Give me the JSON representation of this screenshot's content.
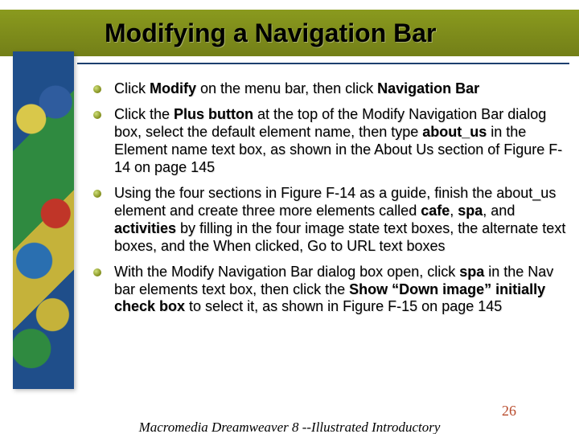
{
  "title": "Modifying a Navigation Bar",
  "bullets": [
    {
      "segments": [
        {
          "t": "Click "
        },
        {
          "t": "Modify",
          "b": true
        },
        {
          "t": " on the menu bar, then click "
        },
        {
          "t": "Navigation Bar",
          "b": true
        }
      ]
    },
    {
      "segments": [
        {
          "t": "Click the "
        },
        {
          "t": "Plus button",
          "b": true
        },
        {
          "t": " at the top of the Modify Navigation Bar dialog box, select the default element name, then type "
        },
        {
          "t": "about_us",
          "b": true
        },
        {
          "t": " in the Element name text box, as shown in the About Us section of Figure F-14 on page 145"
        }
      ]
    },
    {
      "segments": [
        {
          "t": "Using the four sections in Figure F-14 as a guide, finish the about_us element and create three more elements called "
        },
        {
          "t": "cafe",
          "b": true
        },
        {
          "t": ", "
        },
        {
          "t": "spa",
          "b": true
        },
        {
          "t": ", and "
        },
        {
          "t": "activities",
          "b": true
        },
        {
          "t": " by filling in the four image state text boxes, the alternate text boxes, and the When clicked, Go to URL text boxes"
        }
      ]
    },
    {
      "segments": [
        {
          "t": "With the Modify Navigation Bar dialog box open, click "
        },
        {
          "t": "spa",
          "b": true
        },
        {
          "t": " in the Nav bar elements text box, then click the "
        },
        {
          "t": "Show “Down image” initially check box",
          "b": true
        },
        {
          "t": " to select it, as shown in Figure F-15 on page 145"
        }
      ]
    }
  ],
  "footer": "Macromedia Dreamweaver 8 --Illustrated Introductory",
  "page": "26"
}
